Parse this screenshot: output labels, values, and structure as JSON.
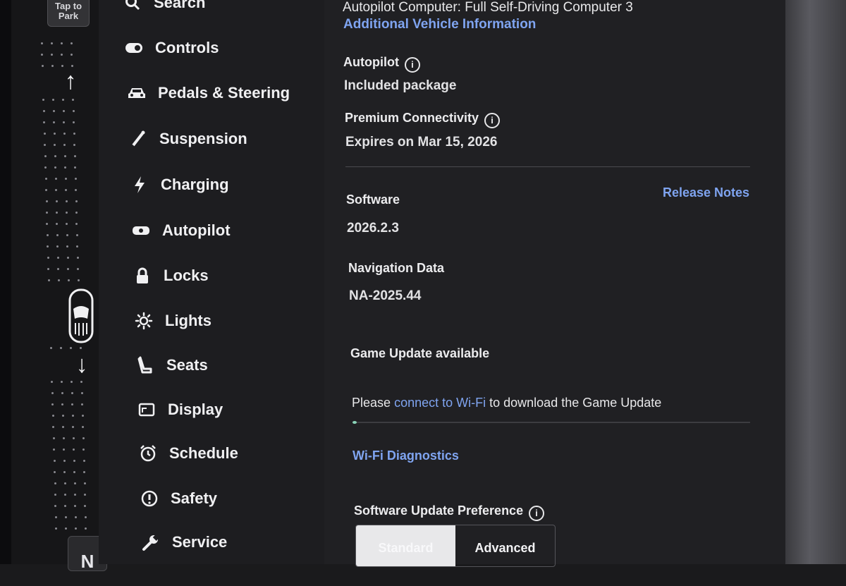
{
  "gear": {
    "park_label_line1": "Tap to",
    "park_label_line2": "Park",
    "neutral": "N",
    "up_arrow": "↑",
    "down_arrow": "↓"
  },
  "menu": {
    "items": [
      {
        "label": "Search",
        "icon": "search-icon"
      },
      {
        "label": "Controls",
        "icon": "toggle-icon"
      },
      {
        "label": "Pedals & Steering",
        "icon": "car-icon"
      },
      {
        "label": "Suspension",
        "icon": "suspension-icon"
      },
      {
        "label": "Charging",
        "icon": "lightning-icon"
      },
      {
        "label": "Autopilot",
        "icon": "steering-wheel-icon"
      },
      {
        "label": "Locks",
        "icon": "lock-icon"
      },
      {
        "label": "Lights",
        "icon": "sun-icon"
      },
      {
        "label": "Seats",
        "icon": "seat-icon"
      },
      {
        "label": "Display",
        "icon": "display-icon"
      },
      {
        "label": "Schedule",
        "icon": "alarm-clock-icon"
      },
      {
        "label": "Safety",
        "icon": "exclamation-circle-icon"
      },
      {
        "label": "Service",
        "icon": "wrench-icon"
      }
    ]
  },
  "content": {
    "autopilot_computer": "Autopilot Computer: Full Self-Driving Computer 3",
    "additional_info_link": "Additional Vehicle Information",
    "autopilot_header": "Autopilot",
    "autopilot_value": "Included package",
    "premium_header": "Premium Connectivity",
    "premium_value": "Expires on Mar 15, 2026",
    "software_header": "Software",
    "release_notes_link": "Release Notes",
    "software_version": "2026.2.3",
    "nav_header": "Navigation Data",
    "nav_value": "NA-2025.44",
    "game_update": "Game Update available",
    "wifi_prompt_pre": "Please",
    "wifi_prompt_link": "connect to Wi-Fi",
    "wifi_prompt_post": "to download the Game Update",
    "download_progress": 0.01,
    "wifi_diag_link": "Wi-Fi Diagnostics",
    "update_pref_header": "Software Update Preference",
    "pref_standard": "Standard",
    "pref_advanced": "Advanced",
    "info_glyph": "i"
  },
  "colors": {
    "link": "#7fa4f0",
    "background": "#202023",
    "text": "#e8e8ea"
  }
}
